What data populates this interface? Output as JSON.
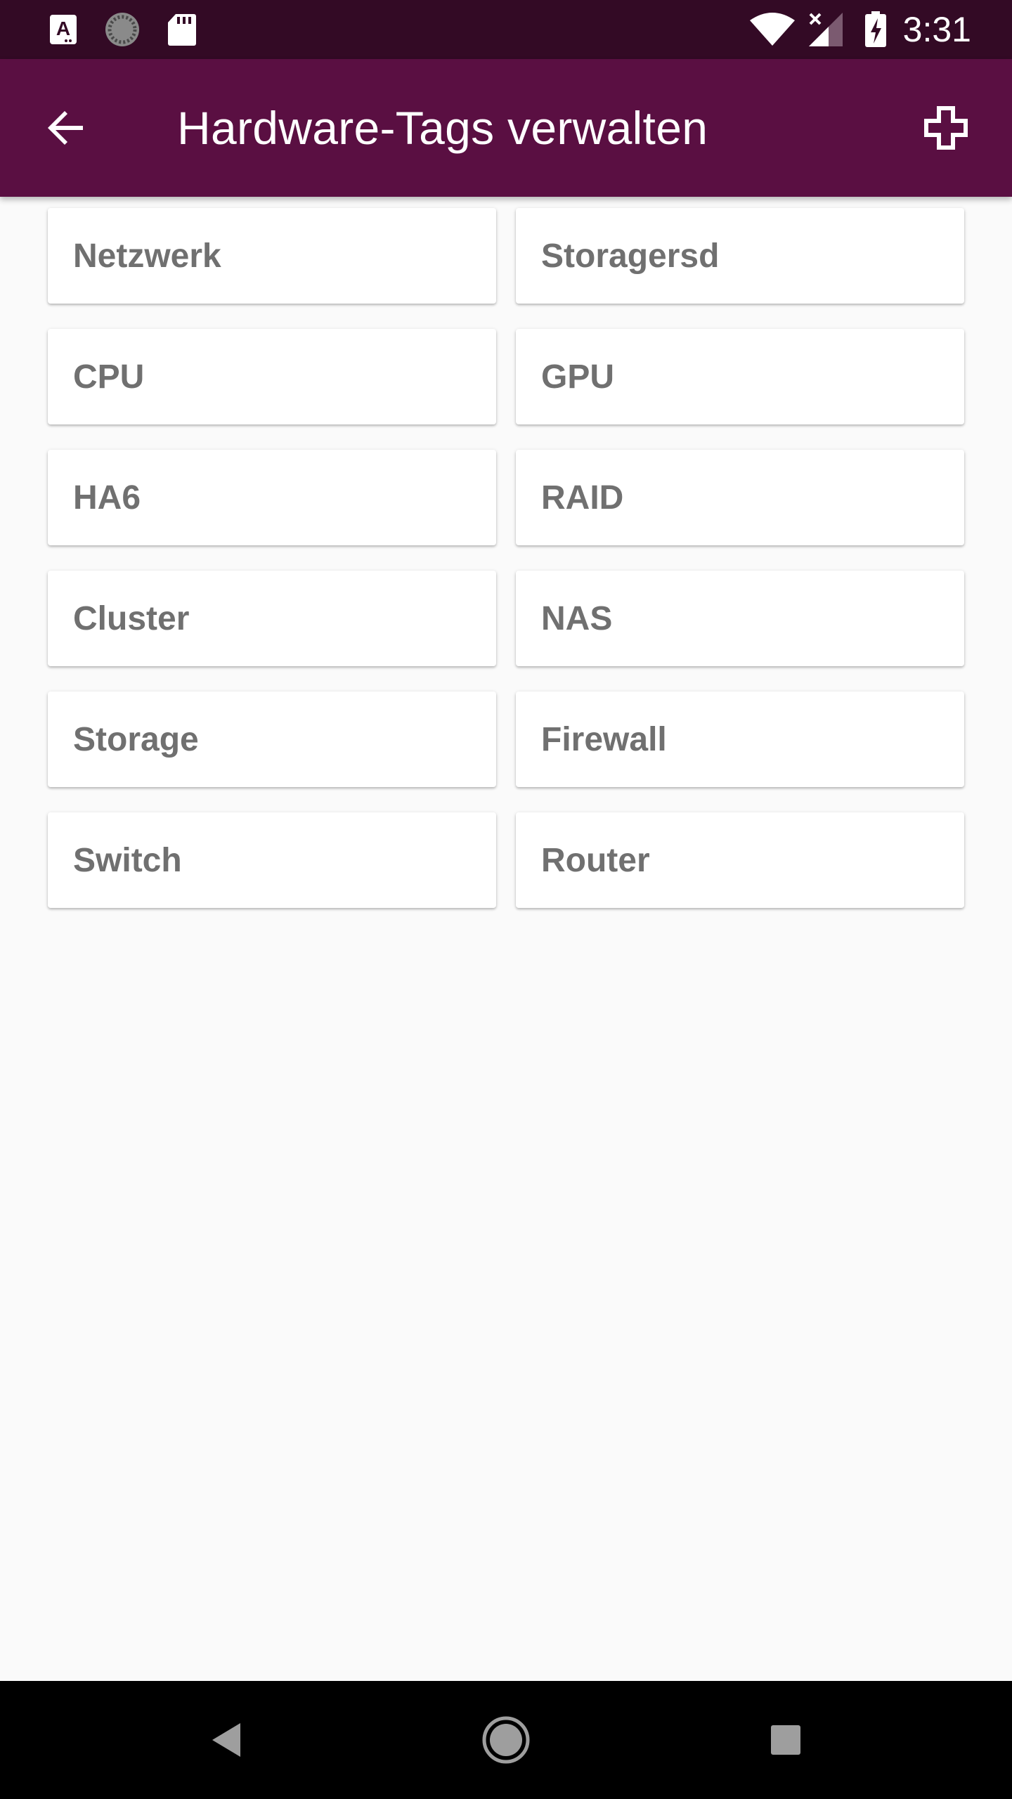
{
  "status_bar": {
    "time": "3:31",
    "icons": [
      "accessibility-a-icon",
      "sync-progress-icon",
      "sd-card-icon",
      "wifi-icon",
      "cellular-no-signal-icon",
      "battery-charging-icon"
    ]
  },
  "app_bar": {
    "title": "Hardware-Tags verwalten",
    "back_icon": "arrow-back-icon",
    "add_icon": "plus-icon",
    "background_color": "#5a0f42"
  },
  "tags": [
    {
      "label": "Netzwerk"
    },
    {
      "label": "Storagersd"
    },
    {
      "label": "CPU"
    },
    {
      "label": "GPU"
    },
    {
      "label": "HA6"
    },
    {
      "label": "RAID"
    },
    {
      "label": "Cluster"
    },
    {
      "label": "NAS"
    },
    {
      "label": "Storage"
    },
    {
      "label": "Firewall"
    },
    {
      "label": "Switch"
    },
    {
      "label": "Router"
    }
  ],
  "nav_bar": {
    "buttons": [
      "nav-back-icon",
      "nav-home-icon",
      "nav-recents-icon"
    ]
  }
}
